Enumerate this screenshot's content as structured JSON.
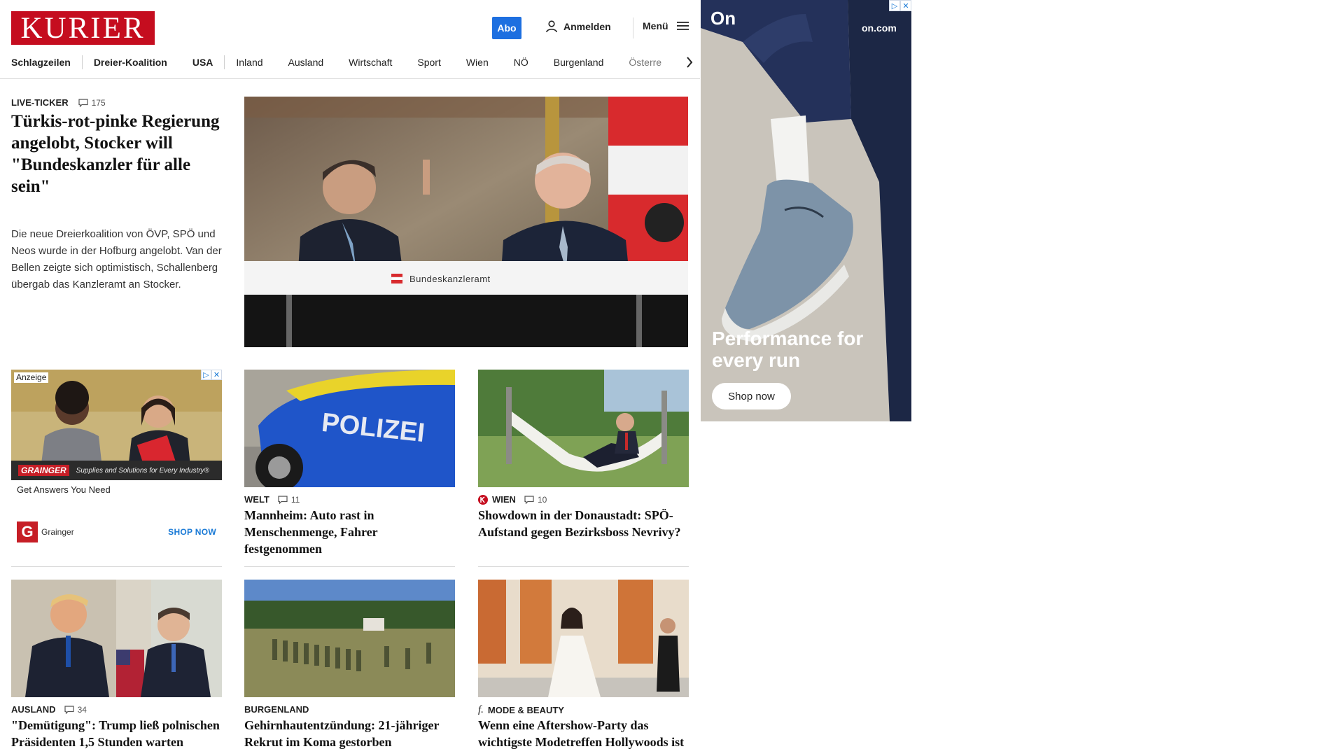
{
  "header": {
    "logo_text": "KURIER",
    "abo_label": "Abo",
    "login_label": "Anmelden",
    "menu_label": "Menü",
    "nav_items": [
      "Schlagzeilen",
      "Dreier-Koalition",
      "USA",
      "Inland",
      "Ausland",
      "Wirtschaft",
      "Sport",
      "Wien",
      "NÖ",
      "Burgenland",
      "Österre"
    ]
  },
  "lead": {
    "category": "LIVE-TICKER",
    "comments": "175",
    "title": "Türkis-rot-pinke Regierung angelobt, Stocker will \"Bundeskanzler für alle sein\"",
    "teaser": "Die neue Dreierkoalition von ÖVP, SPÖ und Neos wurde in der Hofburg angelobt. Van der Bellen zeigte sich optimistisch, Schallenberg übergab das Kanzleramt an Stocker.",
    "image_caption": "Bundeskanzleramt"
  },
  "small_ad": {
    "label": "Anzeige",
    "brand": "GRAINGER",
    "tagline": "Supplies and Solutions for Every Industry®",
    "headline": "Get Answers You Need",
    "advertiser": "Grainger",
    "cta": "SHOP NOW"
  },
  "cards": [
    {
      "category": "WELT",
      "comments": "11",
      "title": "Mannheim: Auto rast in Menschenmenge, Fahrer festgenommen",
      "image_text": "POLIZEI"
    },
    {
      "category": "WIEN",
      "comments": "10",
      "title": "Showdown in der Donaustadt: SPÖ-Aufstand gegen Bezirksboss Nevrivy?"
    },
    {
      "category": "AUSLAND",
      "comments": "34",
      "title": "\"Demütigung\": Trump ließ polnischen Präsidenten 1,5 Stunden warten"
    },
    {
      "category": "BURGENLAND",
      "title": "Gehirnhautentzündung: 21-jähriger Rekrut im Koma gestorben"
    },
    {
      "category": "MODE & BEAUTY",
      "title": "Wenn eine Aftershow-Party das wichtigste Modetreffen Hollywoods ist"
    }
  ],
  "big_ad": {
    "logo": "On",
    "domain": "on.com",
    "headline": "Performance for every run",
    "cta": "Shop now"
  }
}
